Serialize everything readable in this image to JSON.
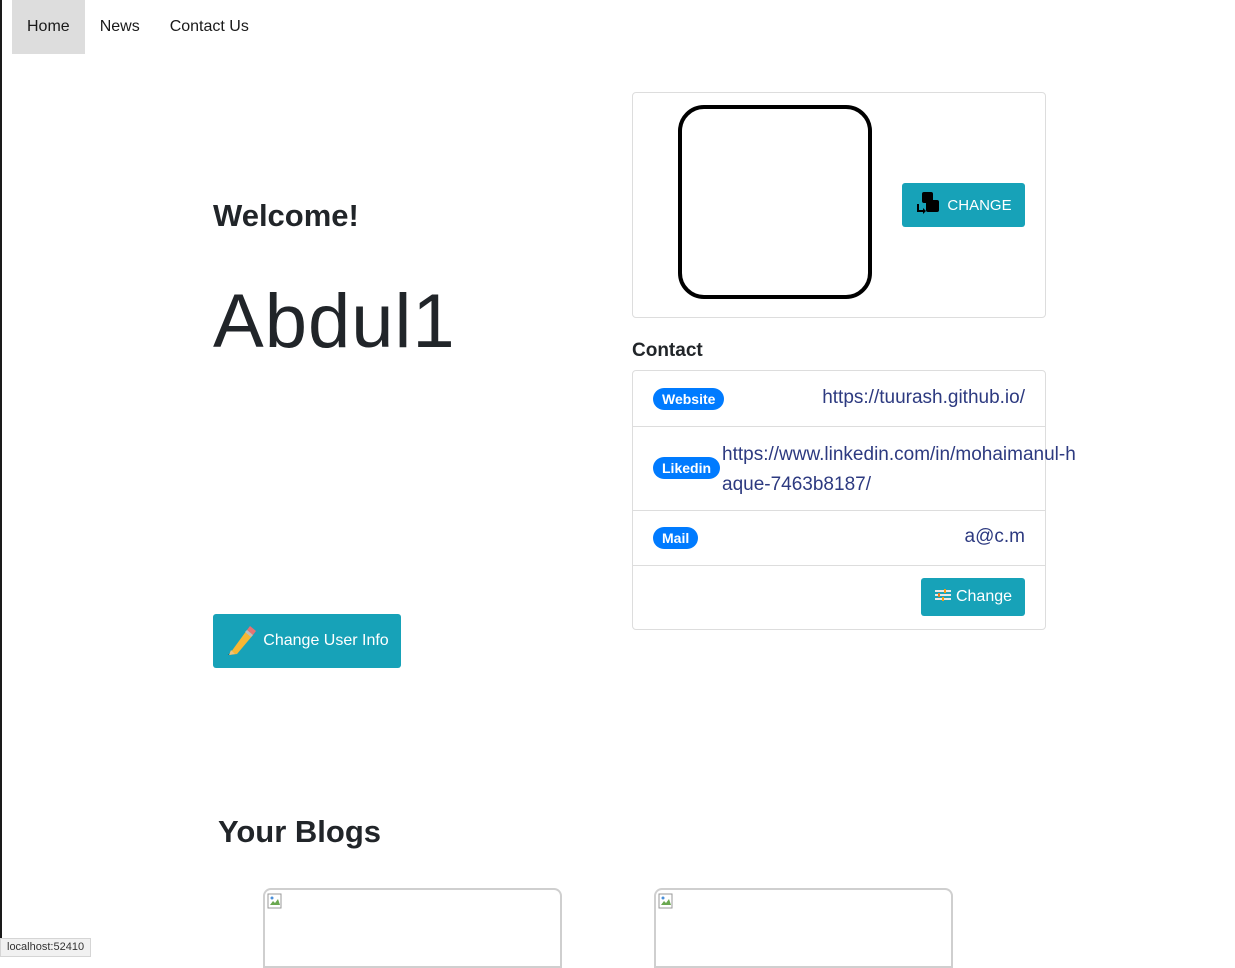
{
  "nav": {
    "items": [
      {
        "label": "Home",
        "active": true
      },
      {
        "label": "News",
        "active": false
      },
      {
        "label": "Contact Us",
        "active": false
      }
    ]
  },
  "profile": {
    "welcome": "Welcome!",
    "username": "Abdul1",
    "change_user_info_label": "Change User Info"
  },
  "avatar": {
    "change_label": "CHANGE"
  },
  "contact": {
    "title": "Contact",
    "website": {
      "badge": "Website",
      "value": "https://tuurash.github.io/"
    },
    "linkedin": {
      "badge": "Likedin",
      "value": "https://www.linkedin.com/in/mohaimanul-haque-7463b8187/"
    },
    "mail": {
      "badge": "Mail",
      "value": "a@c.m"
    },
    "change_label": "Change"
  },
  "blogs": {
    "title": "Your Blogs"
  },
  "status_bar": {
    "url": "localhost:52410"
  },
  "colors": {
    "accent": "#17a2b8",
    "badge": "#007bff",
    "link": "#2d3a80",
    "nav_active": "#dddddd"
  }
}
